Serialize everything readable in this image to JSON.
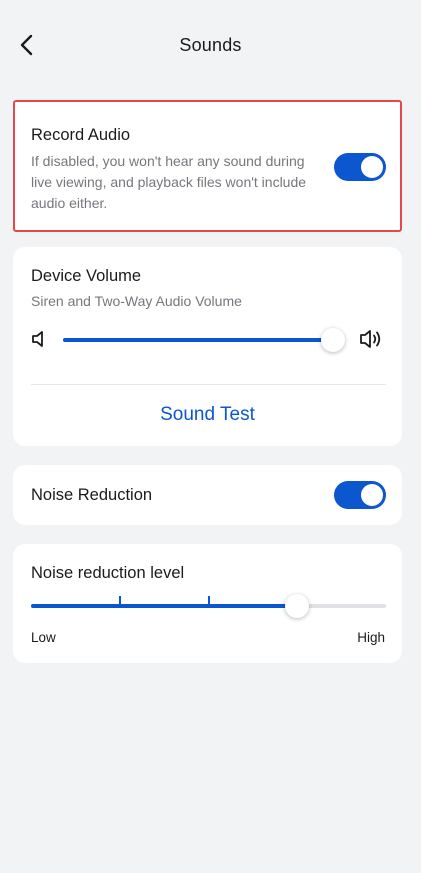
{
  "header": {
    "title": "Sounds",
    "back_icon": "chevron-left-icon"
  },
  "record_audio": {
    "label": "Record Audio",
    "description": "If disabled, you won't hear any sound during live viewing, and playback files won't include audio either.",
    "enabled": true
  },
  "device_volume": {
    "label": "Device Volume",
    "description": "Siren and Two-Way Audio Volume",
    "level": 1.0,
    "sound_test_label": "Sound Test"
  },
  "noise_reduction": {
    "label": "Noise Reduction",
    "enabled": true
  },
  "noise_reduction_level": {
    "label": "Noise reduction level",
    "min_label": "Low",
    "max_label": "High",
    "steps": 5,
    "level_index": 3
  },
  "colors": {
    "accent": "#0c56d0",
    "highlight_border": "#e4484a",
    "background": "#f2f3f5"
  }
}
